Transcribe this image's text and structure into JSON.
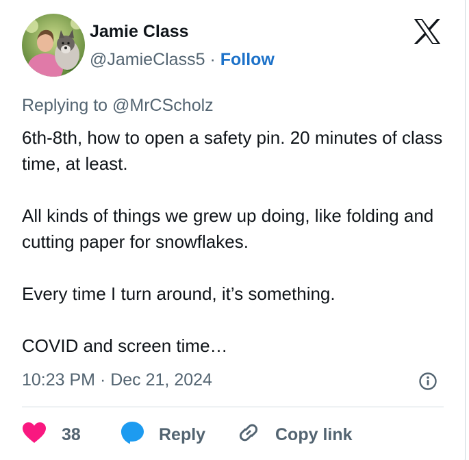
{
  "author": {
    "name": "Jamie Class",
    "handle": "@JamieClass5",
    "separator": "·",
    "follow_label": "Follow"
  },
  "reply_context": {
    "prefix": "Replying to",
    "mention": "@MrCScholz"
  },
  "tweet": {
    "paragraphs": [
      "6th-8th, how to open a safety pin. 20 minutes of class time, at least.",
      "All kinds of things we grew up doing, like folding and cutting paper for snowflakes.",
      "Every time I turn around, it’s something.",
      "COVID and screen time…"
    ],
    "timestamp": "10:23 PM · Dec 21, 2024"
  },
  "actions": {
    "like_count": "38",
    "reply_label": "Reply",
    "copy_link_label": "Copy link"
  },
  "icons": {
    "platform": "x-logo-icon",
    "info": "info-icon",
    "like": "heart-icon",
    "reply": "speech-bubble-icon",
    "copy": "link-icon"
  },
  "colors": {
    "heart": "#f91880",
    "reply_bubble": "#1d9bf0",
    "follow": "#1d72c9",
    "muted_text": "#536471",
    "primary_text": "#0f1419",
    "border": "#cfd9de"
  }
}
